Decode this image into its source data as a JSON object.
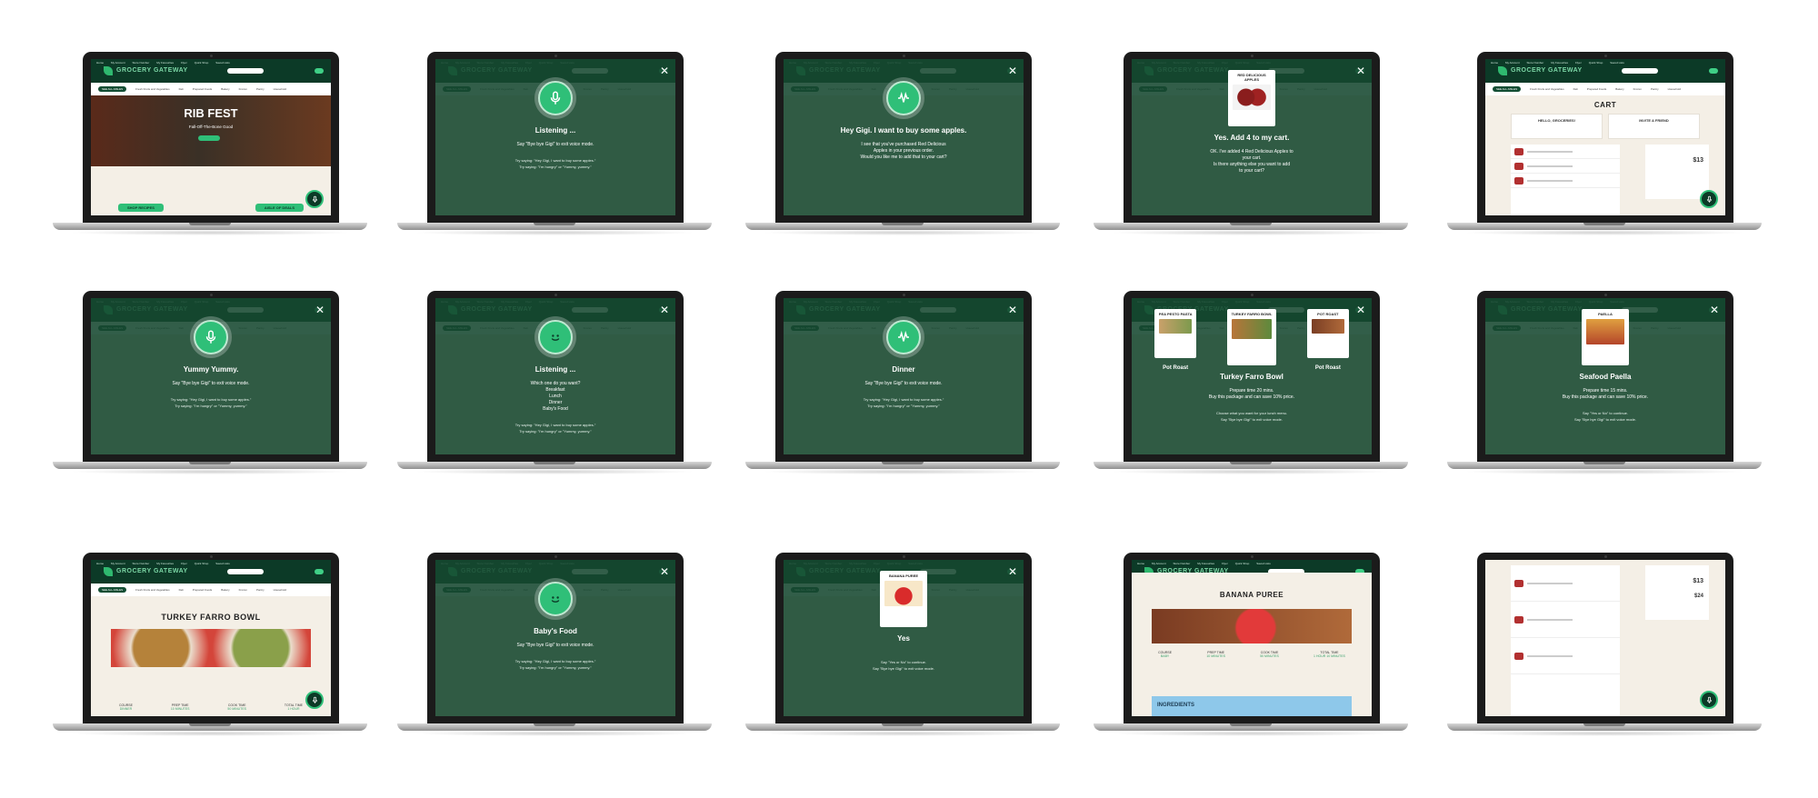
{
  "site": {
    "brand": "GROCERY GATEWAY",
    "topbar_left": "Home",
    "topbar_right": [
      "My Account",
      "Store Number",
      "My Favourites",
      "Flyer",
      "Quick Shop",
      "Saved Lists"
    ],
    "nav": [
      "SEE ALL AISLES",
      "Fresh Fruits and Vegetables",
      "Deli",
      "Prepared Foods",
      "Bakery",
      "Frozen",
      "Pantry",
      "Household"
    ]
  },
  "screens": [
    {
      "kind": "home",
      "banner": "RIB FEST",
      "banner_sub": "Fall-Off-The-Bone Good",
      "cta_1": "SHOP RECIPES",
      "cta_2": "AISLE OF DEALS"
    },
    {
      "kind": "voice",
      "icon": "mic",
      "title": "Listening ...",
      "body": [
        "Say \"Bye bye Gigi\" to exit voice mode."
      ],
      "hints": [
        "Try saying: \"Hey Gigi, I want to buy some apples.\"",
        "Try saying: \"I'm hungry\" or \"Yummy, yummy.\""
      ]
    },
    {
      "kind": "voice",
      "icon": "wave",
      "title": "Hey Gigi. I want to buy some apples.",
      "body": [
        "I see that you've purchased Red Delicious",
        "Apples in your previous order.",
        "Would you like me to add that to your cart?"
      ],
      "hints": []
    },
    {
      "kind": "product",
      "card_title": "RED DELICIOUS APPLES",
      "title": "Yes. Add 4 to my cart.",
      "body": [
        "OK. I've added 4 Red Delicious Apples to",
        "your cart.",
        "Is there anything else you want to add",
        "to your cart?"
      ]
    },
    {
      "kind": "cart",
      "heading": "CART",
      "promo_1": "HELLO, GROCERIES!",
      "promo_2": "INVITE A FRIEND",
      "total": "$13"
    },
    {
      "kind": "voice",
      "icon": "mic",
      "title": "Yummy Yummy.",
      "body": [
        "Say \"Bye bye Gigi\" to exit voice mode."
      ],
      "hints": [
        "Try saying: \"Hey Gigi, I want to buy some apples.\"",
        "Try saying: \"I'm hungry\" or \"Yummy, yummy.\""
      ]
    },
    {
      "kind": "voice",
      "icon": "face",
      "title": "Listening ...",
      "body": [
        "Which one do you want?",
        "Breakfast",
        "Lunch",
        "Dinner",
        "Baby's Food"
      ],
      "hints": [
        "Try saying: \"Hey Gigi, I want to buy some apples.\"",
        "Try saying: \"I'm hungry\" or \"Yummy, yummy.\""
      ]
    },
    {
      "kind": "voice",
      "icon": "wave",
      "title": "Dinner",
      "body": [
        "Say \"Bye bye Gigi\" to exit voice mode."
      ],
      "hints": [
        "Try saying: \"Hey Gigi, I want to buy some apples.\"",
        "Try saying: \"I'm hungry\" or \"Yummy, yummy.\""
      ]
    },
    {
      "kind": "choices",
      "cards": [
        {
          "title": "PEA PESTO PASTA",
          "label": "Pot Roast"
        },
        {
          "title": "TURKEY FARRO BOWL",
          "label": "Turkey Farro Bowl"
        },
        {
          "title": "POT ROAST",
          "label": "Pot Roast"
        }
      ],
      "body": [
        "Prepare time 20 mins.",
        "Buy this package and can save 10% price."
      ],
      "hints": [
        "Choose what you want for your lunch menu.",
        "Say \"Bye bye Gigi\" to exit voice mode."
      ]
    },
    {
      "kind": "single",
      "card_title": "PAELLA",
      "title": "Seafood Paella",
      "body": [
        "Prepare time 15 mins.",
        "Buy this package and can save 10% price."
      ],
      "hints": [
        "Say \"Yes or No\" to continue.",
        "Say \"Bye bye Gigi\" to exit voice mode."
      ]
    },
    {
      "kind": "recipe",
      "title": "TURKEY FARRO BOWL",
      "stats": [
        [
          "COURSE",
          "DINNER"
        ],
        [
          "PREP TIME",
          "10 MINUTES"
        ],
        [
          "COOK TIME",
          "50 MINUTES"
        ],
        [
          "TOTAL TIME",
          "1 HOUR"
        ]
      ]
    },
    {
      "kind": "voice",
      "icon": "face",
      "title": "Baby's Food",
      "body": [
        "Say \"Bye bye Gigi\" to exit voice mode."
      ],
      "hints": [
        "Try saying: \"Hey Gigi, I want to buy some apples.\"",
        "Try saying: \"I'm hungry\" or \"Yummy, yummy.\""
      ]
    },
    {
      "kind": "single",
      "card_title": "BANANA PUREE",
      "title": "Yes",
      "body": [],
      "hints": [
        "Say \"Yes or No\" to continue.",
        "Say \"Bye bye Gigi\" to exit voice mode."
      ]
    },
    {
      "kind": "recipe2",
      "title": "BANANA PUREE",
      "section": "INGREDIENTS",
      "stats": [
        [
          "COURSE",
          "BABY"
        ],
        [
          "PREP TIME",
          "10 MINUTES"
        ],
        [
          "COOK TIME",
          "50 MINUTES"
        ],
        [
          "TOTAL TIME",
          "1 HOUR 10 MINUTES"
        ]
      ]
    },
    {
      "kind": "cart2",
      "total_1": "$13",
      "total_2": "$24"
    }
  ],
  "colors": {
    "forest": "#0c3a27",
    "accent": "#2fbf78",
    "overlay": "#164830"
  }
}
